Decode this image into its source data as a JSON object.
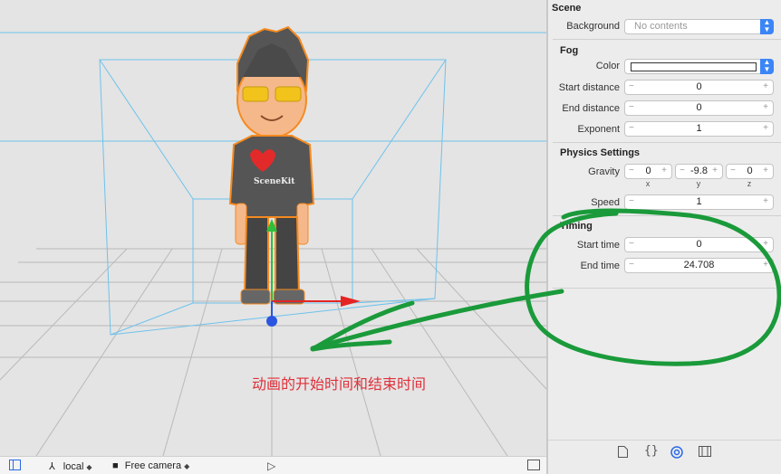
{
  "viewport": {
    "annotation": "动画的开始时间和结束时间",
    "shirt_text": "SceneKit"
  },
  "bottombar": {
    "space_label": "local",
    "camera_label": "Free camera"
  },
  "inspector": {
    "scene": {
      "title": "Scene",
      "background_label": "Background",
      "background_value": "No contents"
    },
    "fog": {
      "title": "Fog",
      "color_label": "Color",
      "start_label": "Start distance",
      "start_value": "0",
      "end_label": "End distance",
      "end_value": "0",
      "exponent_label": "Exponent",
      "exponent_value": "1"
    },
    "physics": {
      "title": "Physics Settings",
      "gravity_label": "Gravity",
      "gravity_x": "0",
      "gravity_y": "-9.8",
      "gravity_z": "0",
      "x_label": "x",
      "y_label": "y",
      "z_label": "z",
      "speed_label": "Speed",
      "speed_value": "1"
    },
    "timing": {
      "title": "Timing",
      "start_label": "Start time",
      "start_value": "0",
      "end_label": "End time",
      "end_value": "24.708"
    },
    "stepper_minus": "−",
    "stepper_plus": "+"
  },
  "colors": {
    "accent": "#3b86f7",
    "annotation": "#e0303a",
    "highlight": "#1a9a3a"
  }
}
